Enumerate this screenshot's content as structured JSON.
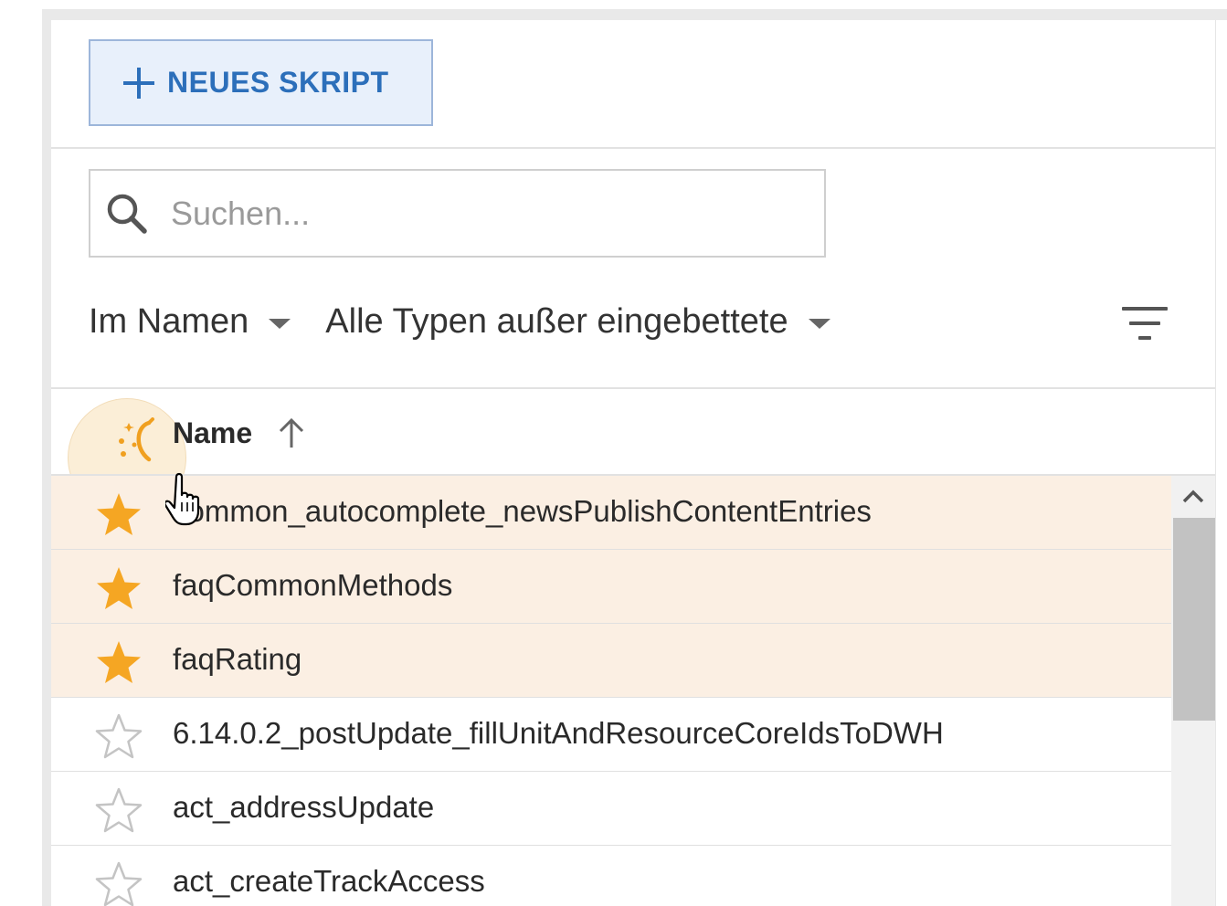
{
  "toolbar": {
    "new_script_label": "NEUES SKRIPT"
  },
  "search": {
    "placeholder": "Suchen...",
    "value": ""
  },
  "filters": {
    "scope_label": "Im Namen",
    "type_label": "Alle Typen außer eingebettete"
  },
  "table": {
    "name_header": "Name",
    "sort_direction": "ascending",
    "rows": [
      {
        "name": "common_autocomplete_newsPublishContentEntries",
        "favorite": true
      },
      {
        "name": "faqCommonMethods",
        "favorite": true
      },
      {
        "name": "faqRating",
        "favorite": true
      },
      {
        "name": "6.14.0.2_postUpdate_fillUnitAndResourceCoreIdsToDWH",
        "favorite": false
      },
      {
        "name": "act_addressUpdate",
        "favorite": false
      },
      {
        "name": "act_createTrackAccess",
        "favorite": false
      }
    ]
  },
  "colors": {
    "accent": "#2c6fba",
    "favorite_star": "#f5a623",
    "favorite_row_bg": "#fbefe3",
    "empty_star": "#c4c4c4"
  },
  "icons": {
    "new_button": "plus-icon",
    "search": "search-icon",
    "filter": "filter-lines-icon",
    "sort": "arrow-up-icon",
    "favorite_header": "sparkle-star-icon",
    "favorite": "star-filled-icon",
    "not_favorite": "star-outline-icon",
    "scroll_up": "chevron-up-icon",
    "cursor": "hand-pointer-icon"
  }
}
